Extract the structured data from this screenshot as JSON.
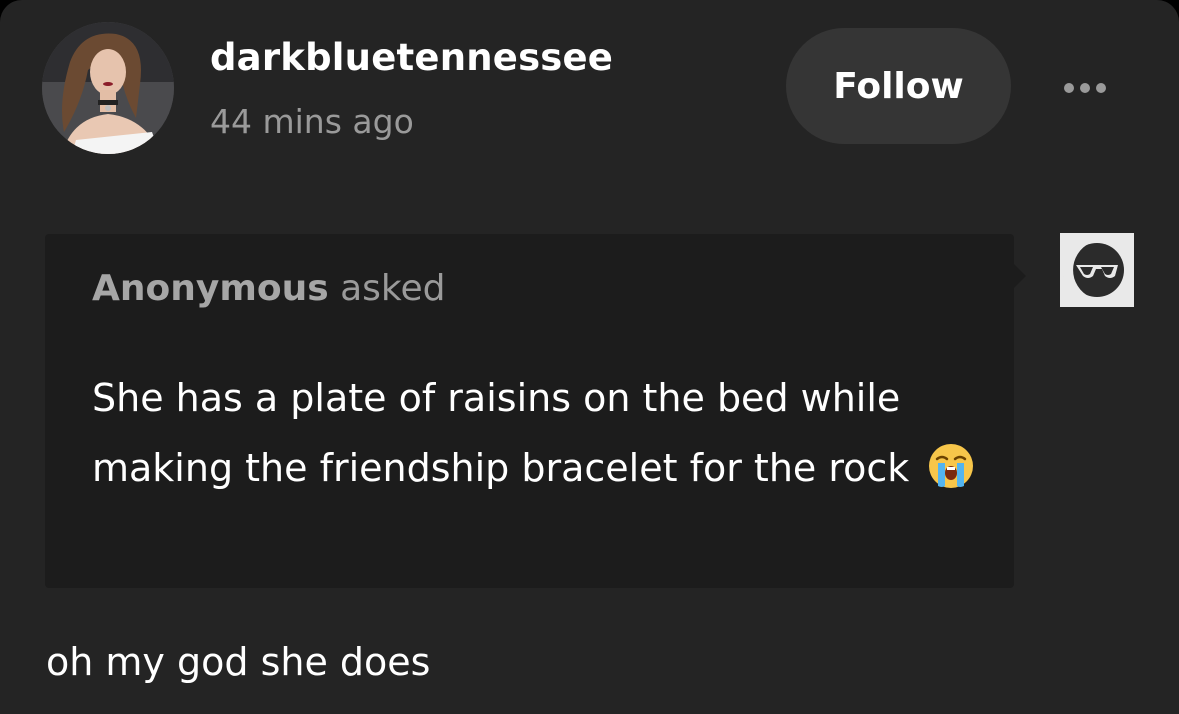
{
  "post": {
    "username": "darkbluetennessee",
    "timestamp": "44 mins ago",
    "follow_label": "Follow",
    "more_icon": "more-horizontal-icon"
  },
  "ask": {
    "asker": "Anonymous",
    "asked_label": "asked",
    "question": "She has a plate of raisins on the bed while making the friendship bracelet for the rock",
    "emoji": "loudly-crying-face-emoji",
    "asker_avatar_icon": "sunglasses-face-icon"
  },
  "answer": {
    "text": "oh my god she does"
  },
  "colors": {
    "card_bg": "#242424",
    "ask_bg": "#1c1c1c",
    "follow_bg": "#353535",
    "muted_text": "#9a9a9a"
  }
}
